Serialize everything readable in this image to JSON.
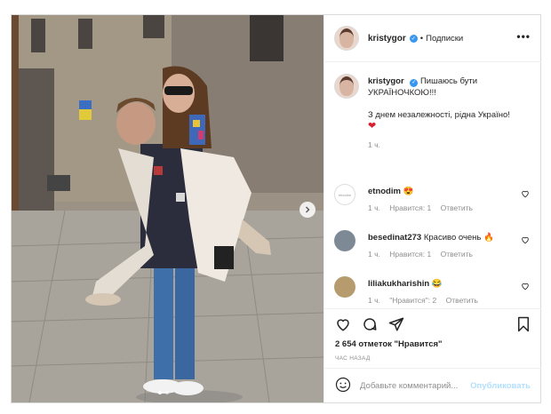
{
  "header": {
    "username": "kristygor",
    "separator": "•",
    "follow_label": "Подписки",
    "more_label": "•••"
  },
  "caption": {
    "username": "kristygor",
    "line1": "Пишаюсь бути УКРАЇНОЧКОЮ!!!",
    "line2": "З днем незалежності, рідна Україно!",
    "emoji": "❤",
    "time": "1 ч."
  },
  "comments": [
    {
      "username": "etnodim",
      "text": "😍",
      "time": "1 ч.",
      "likes": "Нравится: 1",
      "reply": "Ответить",
      "avatar_text": "etnodim"
    },
    {
      "username": "besedinat273",
      "text": "Красиво очень 🔥",
      "time": "1 ч.",
      "likes": "Нравится: 1",
      "reply": "Ответить"
    },
    {
      "username": "liliakukharishin",
      "text": "😂",
      "time": "1 ч.",
      "likes": "\"Нравится\": 2",
      "reply": "Ответить"
    }
  ],
  "actions": {
    "likes_text": "2 654 отметок \"Нравится\"",
    "ago": "ЧАС НАЗАД"
  },
  "add_comment": {
    "placeholder": "Добавьте комментарий...",
    "publish": "Опубликовать"
  },
  "carousel": {
    "current": 1,
    "total": 2
  },
  "colors": {
    "link": "#3897f0",
    "publish_disabled": "#b2dffc",
    "heart": "#d8212f"
  }
}
